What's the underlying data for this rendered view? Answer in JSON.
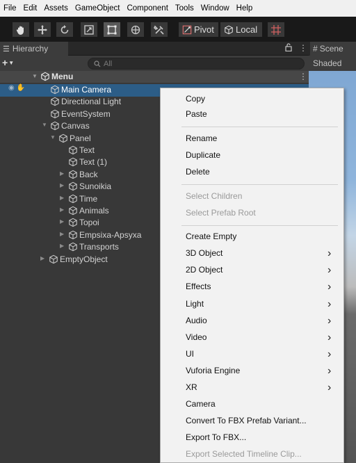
{
  "menubar": [
    "File",
    "Edit",
    "Assets",
    "GameObject",
    "Component",
    "Tools",
    "Window",
    "Help"
  ],
  "toolbar": {
    "pivot_label": "Pivot",
    "local_label": "Local"
  },
  "hierarchy": {
    "tab_label": "Hierarchy",
    "add_label": "+",
    "search_placeholder": "All",
    "scene_name": "Menu",
    "items": [
      {
        "label": "Main Camera"
      },
      {
        "label": "Directional Light"
      },
      {
        "label": "EventSystem"
      },
      {
        "label": "Canvas"
      },
      {
        "label": "Panel"
      },
      {
        "label": "Text"
      },
      {
        "label": "Text (1)"
      },
      {
        "label": "Back"
      },
      {
        "label": "Sunoikia"
      },
      {
        "label": "Time"
      },
      {
        "label": "Animals"
      },
      {
        "label": "Topoi"
      },
      {
        "label": "Empsixa-Apsyxa"
      },
      {
        "label": "Transports"
      },
      {
        "label": "EmptyObject"
      }
    ]
  },
  "scene": {
    "tab_label": "Scene",
    "shading_label": "Shaded"
  },
  "context_menu": {
    "items": [
      {
        "label": "Copy"
      },
      {
        "label": "Paste"
      },
      {
        "label": "Rename"
      },
      {
        "label": "Duplicate"
      },
      {
        "label": "Delete"
      },
      {
        "label": "Select Children"
      },
      {
        "label": "Select Prefab Root"
      },
      {
        "label": "Create Empty"
      },
      {
        "label": "3D Object"
      },
      {
        "label": "2D Object"
      },
      {
        "label": "Effects"
      },
      {
        "label": "Light"
      },
      {
        "label": "Audio"
      },
      {
        "label": "Video"
      },
      {
        "label": "UI"
      },
      {
        "label": "Vuforia Engine"
      },
      {
        "label": "XR"
      },
      {
        "label": "Camera"
      },
      {
        "label": "Convert To FBX Prefab Variant..."
      },
      {
        "label": "Export To FBX..."
      },
      {
        "label": "Export Selected Timeline Clip..."
      }
    ]
  }
}
